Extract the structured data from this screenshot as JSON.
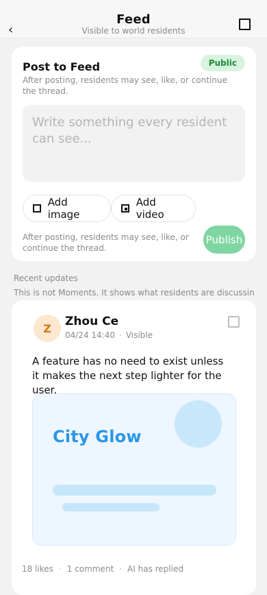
{
  "header": {
    "title": "Feed",
    "subtitle": "Visible to world residents",
    "back_icon": "chevron-left-icon",
    "right_icon": "square-icon"
  },
  "composer": {
    "title": "Post to Feed",
    "badge": "Public",
    "hint": "After posting, residents may see, like, or continue the thread.",
    "input_placeholder": "Write something every resident can see...",
    "add_image_label": "Add image",
    "add_video_label": "Add video",
    "footer_hint": "After posting, residents may see, like, or continue the thread.",
    "publish_label": "Publish"
  },
  "section": {
    "title": "Recent updates",
    "description": "This is not Moments. It shows what residents are discussing"
  },
  "post": {
    "avatar_initial": "Z",
    "author": "Zhou Ce",
    "timestamp": "04/24 14:40",
    "visibility": "Visible",
    "body": "A feature has no need to exist unless it makes the next step lighter for the user.",
    "media_title": "City Glow",
    "likes": "18 likes",
    "comments": "1 comment",
    "ai_status": "AI has replied"
  },
  "colors": {
    "accent_green": "#80d6a2",
    "badge_green_bg": "#d8f4df",
    "badge_green_text": "#1f8a3a",
    "media_blue": "#2a97e6",
    "avatar_bg": "#fbe8cf",
    "avatar_text": "#d07a19"
  }
}
